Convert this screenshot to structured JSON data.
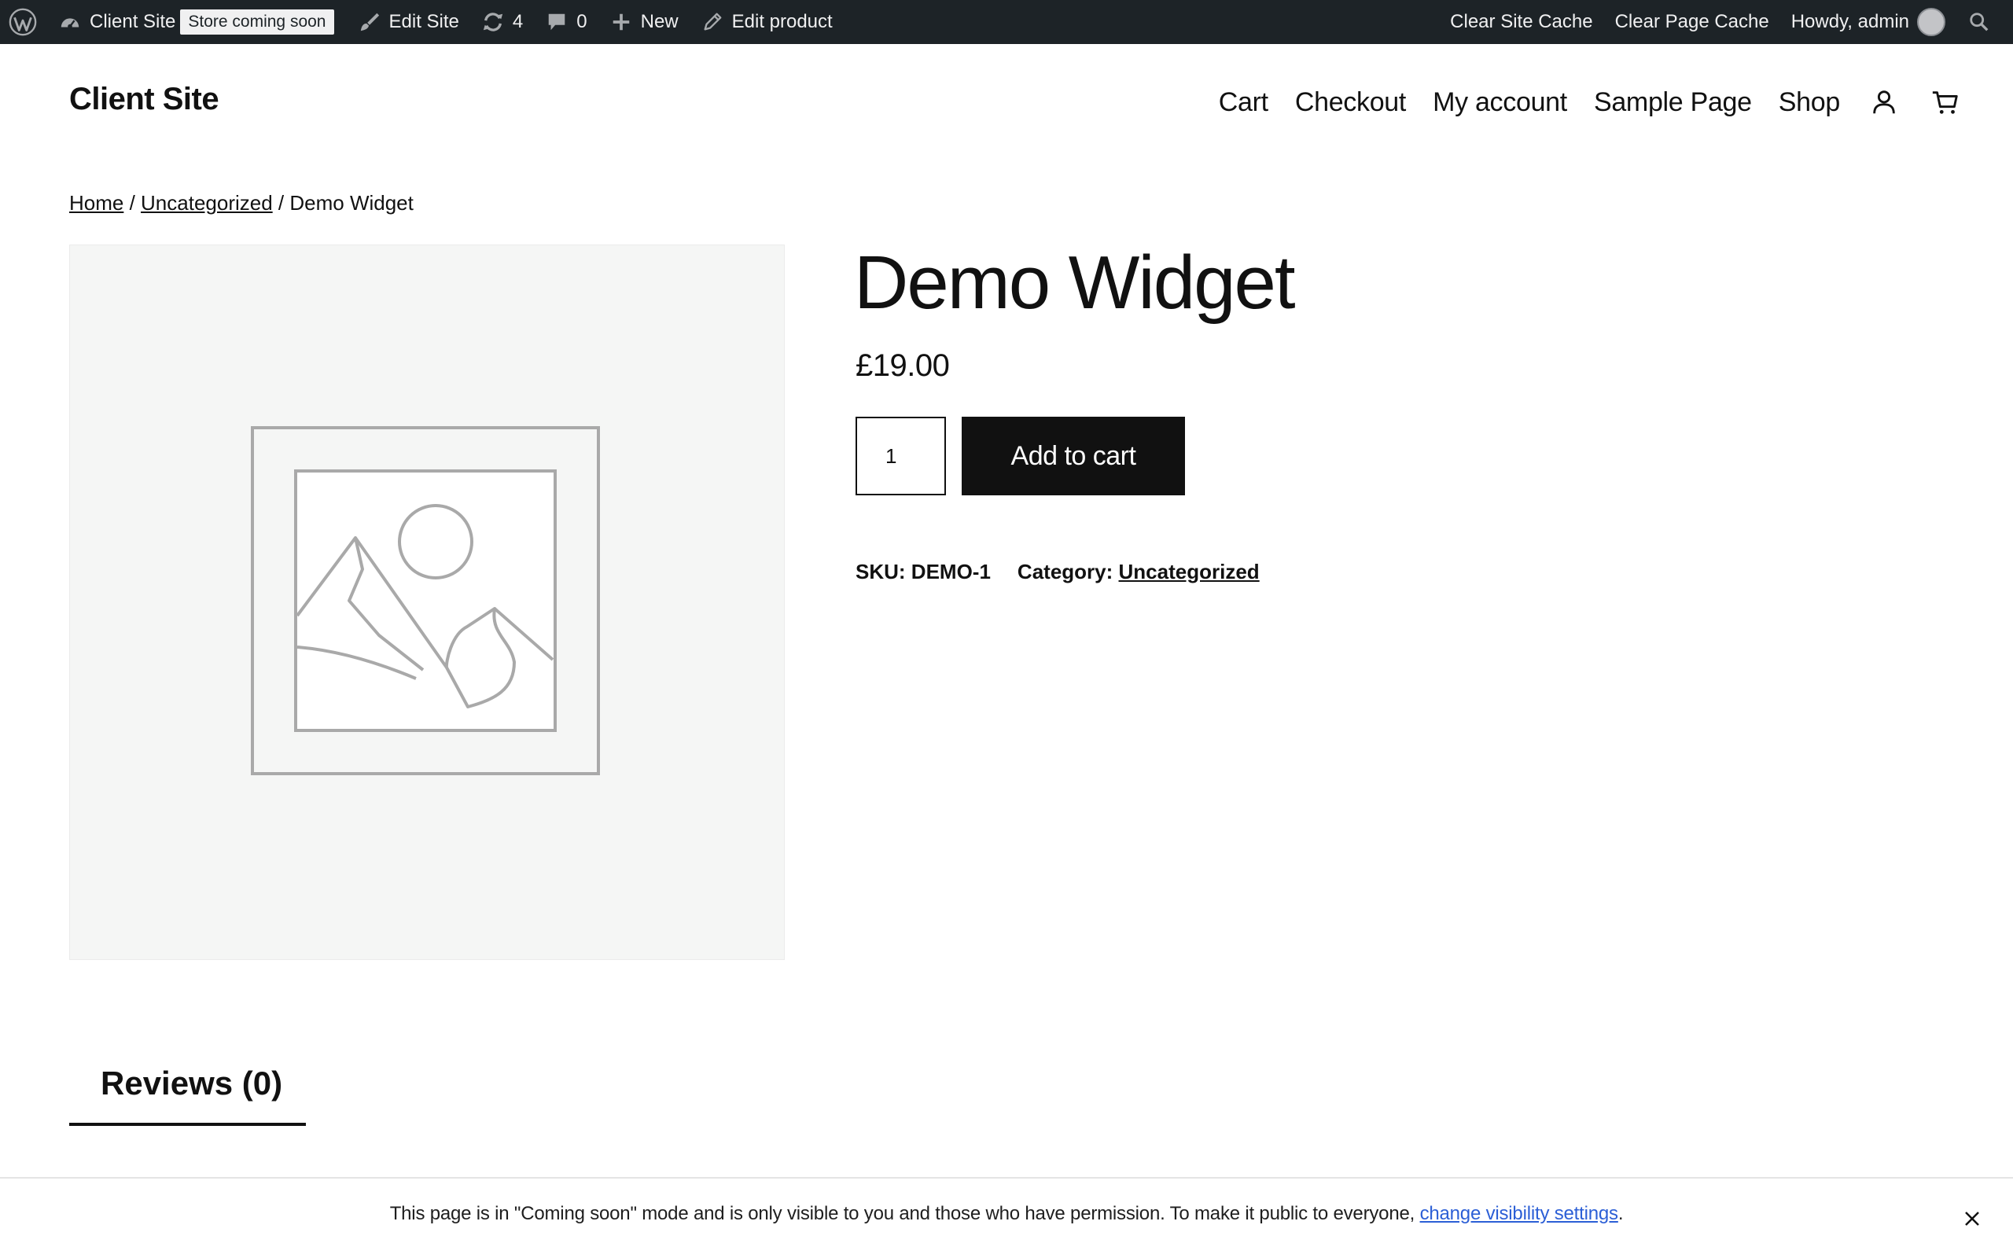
{
  "adminbar": {
    "site_name": "Client Site",
    "store_badge": "Store coming soon",
    "edit_site": "Edit Site",
    "updates_count": "4",
    "comments_count": "0",
    "new_label": "New",
    "edit_product": "Edit product",
    "clear_site_cache": "Clear Site Cache",
    "clear_page_cache": "Clear Page Cache",
    "howdy": "Howdy, admin"
  },
  "header": {
    "site_title": "Client Site",
    "nav": [
      "Cart",
      "Checkout",
      "My account",
      "Sample Page",
      "Shop"
    ]
  },
  "breadcrumb": {
    "home": "Home",
    "sep1": " / ",
    "category": "Uncategorized",
    "sep2": " / ",
    "current": "Demo Widget"
  },
  "product": {
    "title": "Demo Widget",
    "price": "£19.00",
    "quantity": "1",
    "add_to_cart": "Add to cart",
    "sku_label": "SKU:",
    "sku": "DEMO-1",
    "category_label": "Category:",
    "category": "Uncategorized"
  },
  "tabs": {
    "reviews": "Reviews (0)"
  },
  "notice": {
    "text": "This page is in \"Coming soon\" mode and is only visible to you and those who have permission. To make it public to everyone, ",
    "link": "change visibility settings",
    "end": "."
  },
  "colors": {
    "adminbar_bg": "#1d2327",
    "button_bg": "#111111",
    "image_bg": "#f5f6f5",
    "notice_link": "#2c5fd6"
  },
  "icons": [
    "wordpress-logo-icon",
    "dashboard-icon",
    "brush-icon",
    "updates-icon",
    "comment-icon",
    "plus-icon",
    "pencil-icon",
    "search-icon",
    "account-icon",
    "cart-icon",
    "placeholder-image-icon",
    "close-icon"
  ]
}
